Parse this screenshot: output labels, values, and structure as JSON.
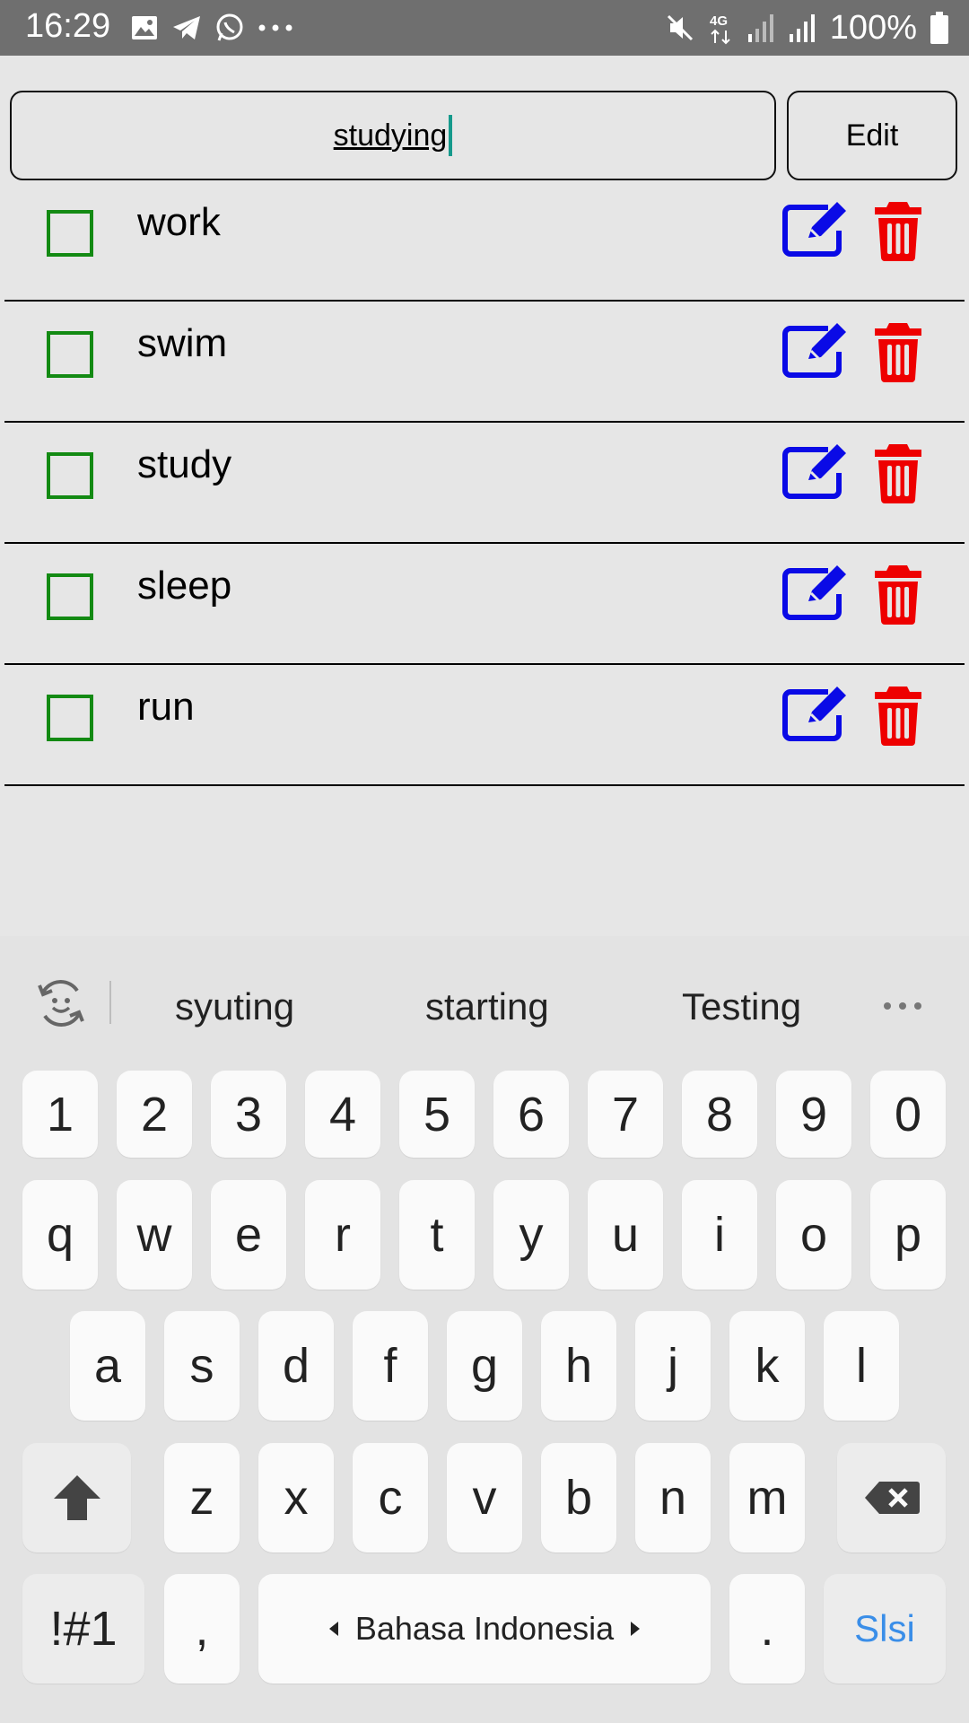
{
  "status_bar": {
    "time": "16:29",
    "battery": "100%",
    "network": "4G",
    "icons": [
      "image-icon",
      "telegram-icon",
      "whatsapp-icon",
      "more-dots-icon",
      "mute-icon",
      "4g-icon",
      "signal-icon",
      "signal-icon",
      "battery-icon"
    ]
  },
  "editor": {
    "input_value": "studying",
    "edit_label": "Edit"
  },
  "todos": [
    {
      "label": "work"
    },
    {
      "label": "swim"
    },
    {
      "label": "study"
    },
    {
      "label": "sleep"
    },
    {
      "label": "run"
    }
  ],
  "colors": {
    "checkbox": "#138a13",
    "edit_icon": "#0a0ae6",
    "delete_icon": "#ee0000",
    "caret": "#159a8c",
    "keyboard_action": "#3a8ee8"
  },
  "keyboard": {
    "suggestions": [
      "syuting",
      "starting",
      "Testing"
    ],
    "row_numbers": [
      "1",
      "2",
      "3",
      "4",
      "5",
      "6",
      "7",
      "8",
      "9",
      "0"
    ],
    "row_q": [
      "q",
      "w",
      "e",
      "r",
      "t",
      "y",
      "u",
      "i",
      "o",
      "p"
    ],
    "row_a": [
      "a",
      "s",
      "d",
      "f",
      "g",
      "h",
      "j",
      "k",
      "l"
    ],
    "row_z": [
      "z",
      "x",
      "c",
      "v",
      "b",
      "n",
      "m"
    ],
    "symbols_label": "!#1",
    "comma_label": ",",
    "space_label": "Bahasa Indonesia",
    "period_label": ".",
    "action_label": "Slsi"
  }
}
